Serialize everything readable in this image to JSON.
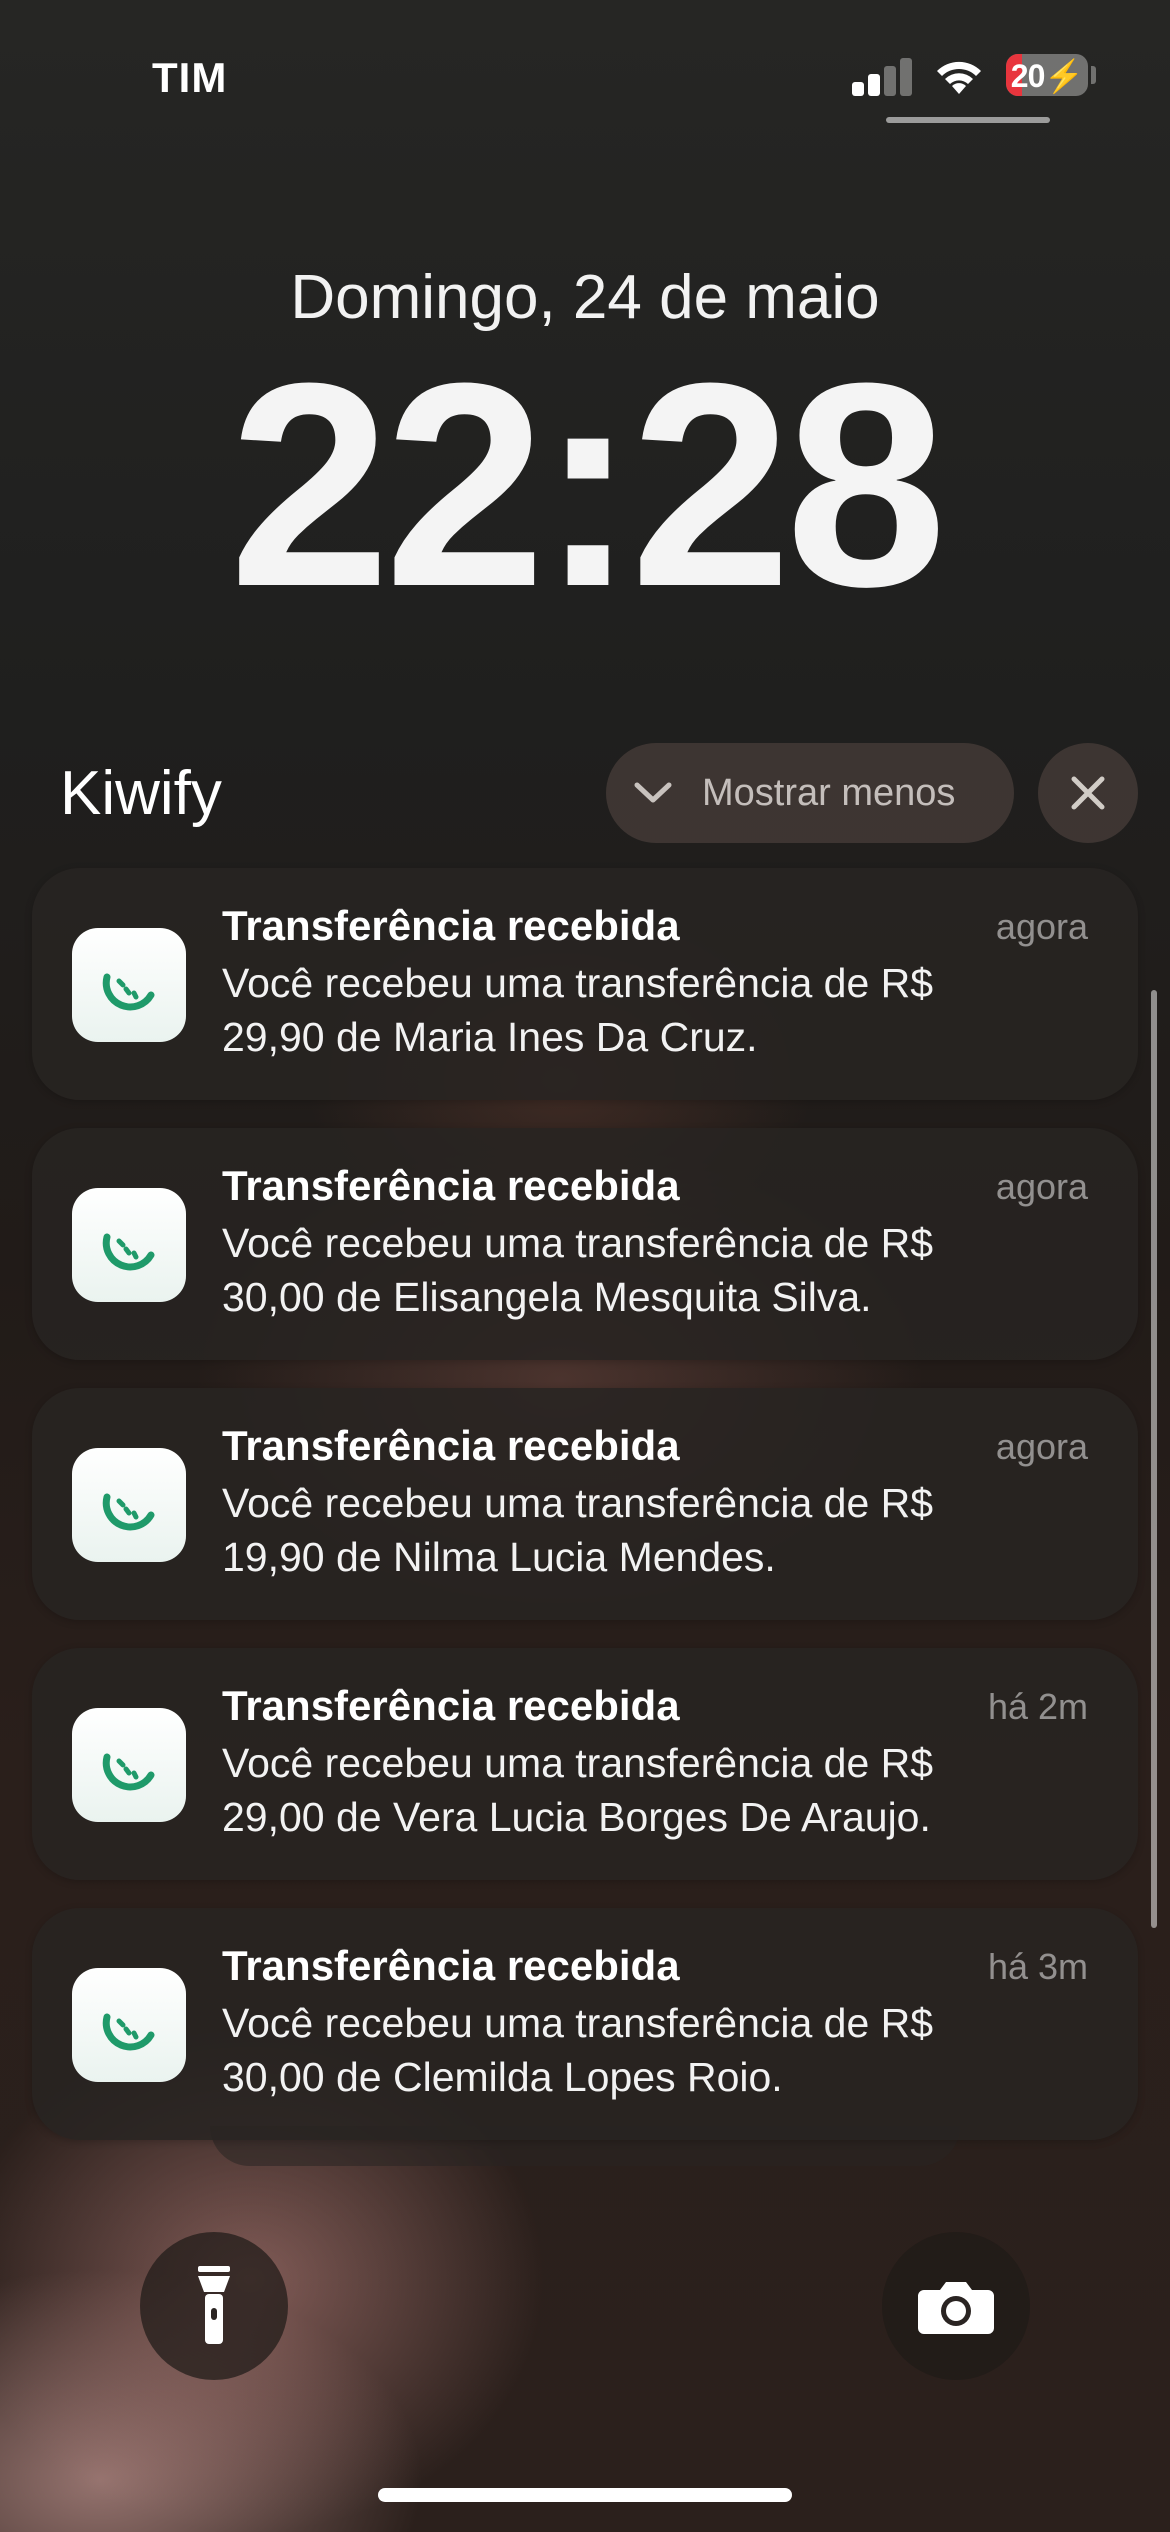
{
  "status_bar": {
    "carrier": "TIM",
    "signal_bars": 2,
    "signal_total": 4,
    "battery_percent": "20",
    "battery_level": 0.2,
    "battery_color": "#e8353d"
  },
  "lock_screen": {
    "date": "Domingo, 24 de maio",
    "time": "22:28"
  },
  "notification_group": {
    "app_name": "Kiwify",
    "show_less_label": "Mostrar menos",
    "accent_color": "#1f9a6a",
    "notifications": [
      {
        "title": "Transferência recebida",
        "time": "agora",
        "line1": "Você recebeu uma transferência de R$",
        "line2": "29,90 de Maria Ines Da Cruz."
      },
      {
        "title": "Transferência recebida",
        "time": "agora",
        "line1": "Você recebeu uma transferência de R$",
        "line2": "30,00 de Elisangela Mesquita Silva."
      },
      {
        "title": "Transferência recebida",
        "time": "agora",
        "line1": "Você recebeu uma transferência de R$",
        "line2": "19,90 de Nilma Lucia Mendes."
      },
      {
        "title": "Transferência recebida",
        "time": "há 2m",
        "line1": "Você recebeu uma transferência de R$",
        "line2": "29,00 de Vera Lucia Borges De Araujo."
      },
      {
        "title": "Transferência recebida",
        "time": "há 3m",
        "line1": "Você recebeu uma transferência de R$",
        "line2": "30,00 de Clemilda Lopes Roio."
      }
    ]
  },
  "controls": {
    "left_icon": "flashlight-icon",
    "right_icon": "camera-icon"
  }
}
